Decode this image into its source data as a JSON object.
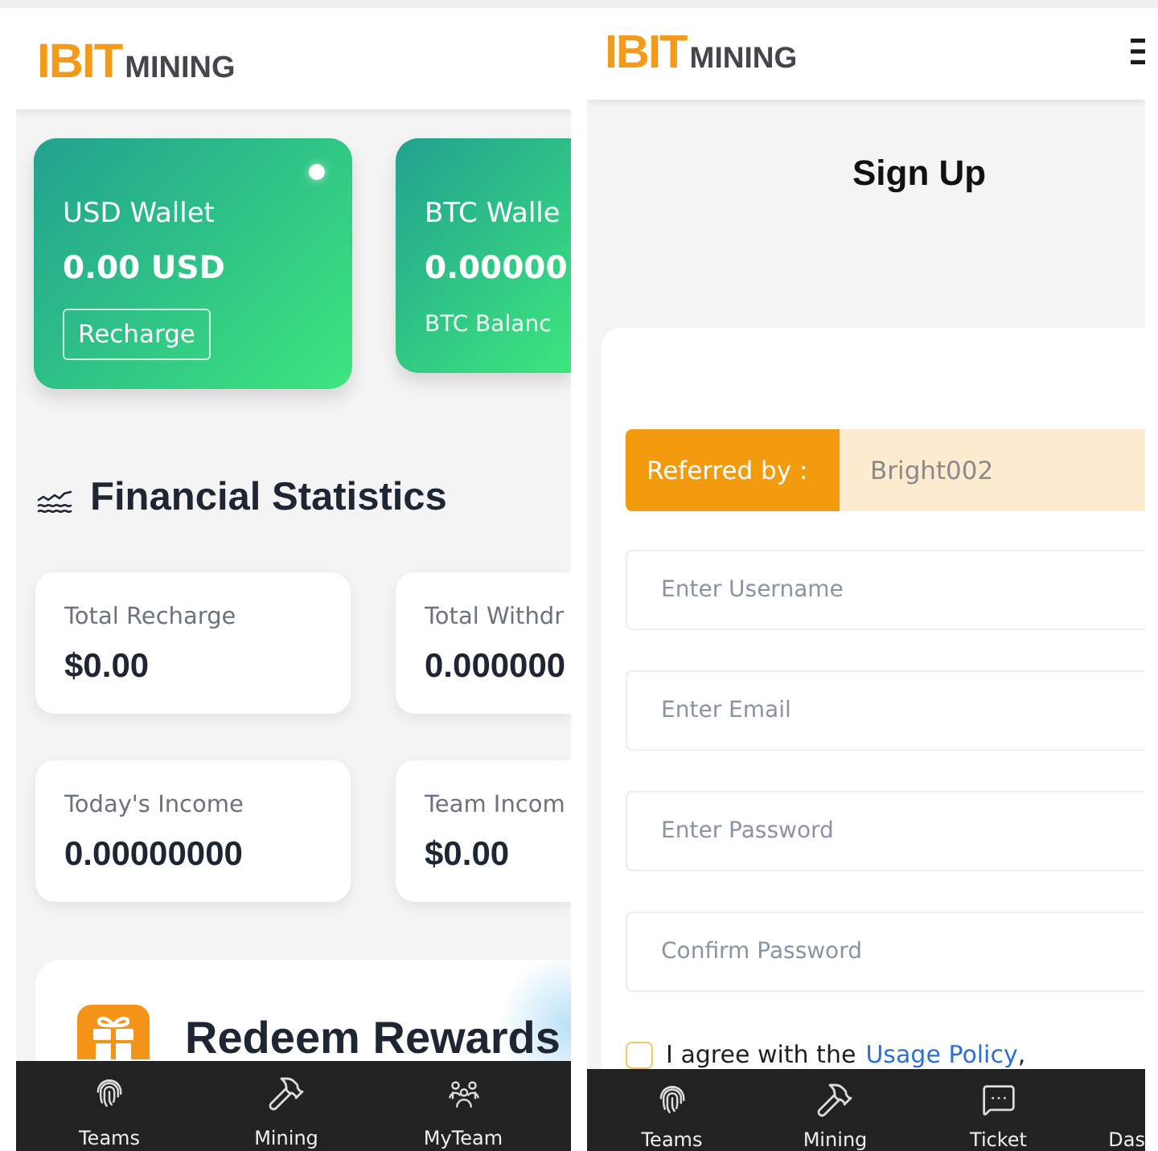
{
  "dashboard_screen": {
    "logo": {
      "brand": "IBIT",
      "product": "MINING"
    },
    "wallets": [
      {
        "title": "USD Wallet",
        "amount": "0.00 USD",
        "button": "Recharge",
        "dot": true
      },
      {
        "title": "BTC Walle",
        "amount": "0.00000",
        "note": "BTC Balanc",
        "dot": false
      }
    ],
    "section_title": "Financial Statistics",
    "stats": [
      {
        "label": "Total Recharge",
        "value": "$0.00"
      },
      {
        "label": "Total Withdr",
        "value": "0.000000"
      },
      {
        "label": "Today's Income",
        "value": "0.00000000"
      },
      {
        "label": "Team Incom",
        "value": "$0.00"
      }
    ],
    "promo": {
      "title": "Redeem Rewards"
    },
    "bottom_nav": [
      {
        "label": "Teams"
      },
      {
        "label": "Mining"
      },
      {
        "label": "MyTeam"
      }
    ]
  },
  "signup_screen": {
    "logo": {
      "brand": "IBIT",
      "product": "MINING"
    },
    "title": "Sign Up",
    "referral": {
      "label": "Referred by :",
      "value": "Bright002"
    },
    "fields": [
      {
        "placeholder": "Enter Username"
      },
      {
        "placeholder": "Enter Email"
      },
      {
        "placeholder": "Enter Password"
      },
      {
        "placeholder": "Confirm Password"
      }
    ],
    "agreement": {
      "checked": false,
      "text": "I agree with the",
      "link": "Usage Policy",
      "after": ","
    },
    "bottom_nav": [
      {
        "label": "Teams"
      },
      {
        "label": "Mining"
      },
      {
        "label": "Ticket"
      },
      {
        "label": "Das"
      }
    ]
  }
}
